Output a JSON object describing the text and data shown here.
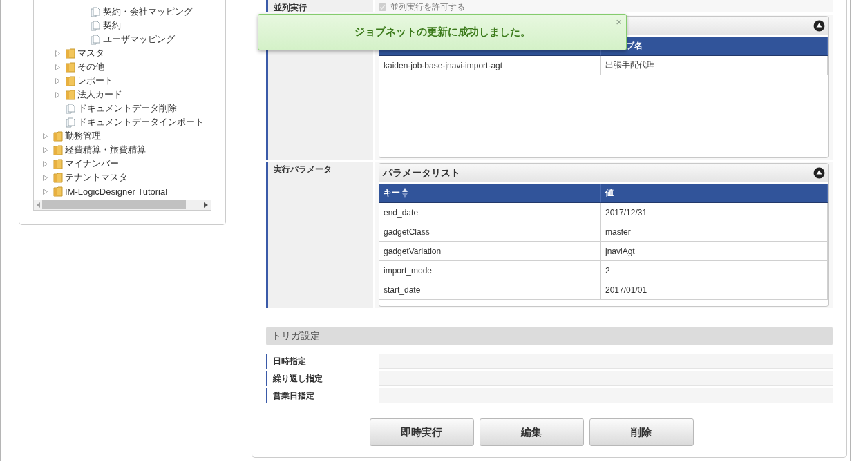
{
  "sidebar": {
    "tree": [
      {
        "children": [
          {
            "children": [
              {
                "children": [
                  {
                    "kind": "file",
                    "label": "契約・会社マッピング"
                  },
                  {
                    "kind": "file",
                    "label": "契約"
                  },
                  {
                    "kind": "file",
                    "label": "ユーザマッピング"
                  }
                ]
              }
            ]
          },
          {
            "kind": "folder",
            "label": "マスタ",
            "expanded": false
          },
          {
            "kind": "folder",
            "label": "その他",
            "expanded": false
          },
          {
            "kind": "folder",
            "label": "レポート",
            "expanded": false
          },
          {
            "kind": "folder",
            "label": "法人カード",
            "expanded": false
          },
          {
            "kind": "file",
            "label": "ドキュメントデータ削除"
          },
          {
            "kind": "file",
            "label": "ドキュメントデータインポート"
          }
        ]
      },
      {
        "kind": "folder",
        "label": "勤務管理",
        "expanded": false
      },
      {
        "kind": "folder",
        "label": "経費精算・旅費精算",
        "expanded": false
      },
      {
        "kind": "folder",
        "label": "マイナンバー",
        "expanded": false
      },
      {
        "kind": "folder",
        "label": "テナントマスタ",
        "expanded": false
      },
      {
        "kind": "folder",
        "label": "IM-LogicDesigner Tutorial",
        "expanded": false
      }
    ]
  },
  "toast": {
    "message": "ジョブネットの更新に成功しました。",
    "close": "×"
  },
  "job_settings": [
    {
      "kind": "checkbox",
      "label": "並列実行",
      "option": "並列実行を許可する",
      "checked": true,
      "disabled": true
    },
    {
      "kind": "table",
      "columns": [
        {},
        {
          "label": "ブ名"
        }
      ],
      "rows": [
        [
          "kaiden-job-base-jnavi-import-agt",
          "出張手配代理"
        ]
      ]
    },
    {
      "kind": "table",
      "label": "実行パラメータ",
      "title": "パラメータリスト",
      "columns": [
        {
          "label": "キー",
          "sortable": true
        },
        {
          "label": "値"
        }
      ],
      "rows": [
        [
          "end_date",
          "2017/12/31"
        ],
        [
          "gadgetClass",
          "master"
        ],
        [
          "gadgetVariation",
          "jnaviAgt"
        ],
        [
          "import_mode",
          "2"
        ],
        [
          "start_date",
          "2017/01/01"
        ]
      ]
    }
  ],
  "trigger": {
    "title": "トリガ設定",
    "rows": [
      {
        "label": "日時指定"
      },
      {
        "label": "繰り返し指定"
      },
      {
        "label": "営業日指定"
      }
    ]
  },
  "buttons": [
    "即時実行",
    "編集",
    "削除"
  ]
}
